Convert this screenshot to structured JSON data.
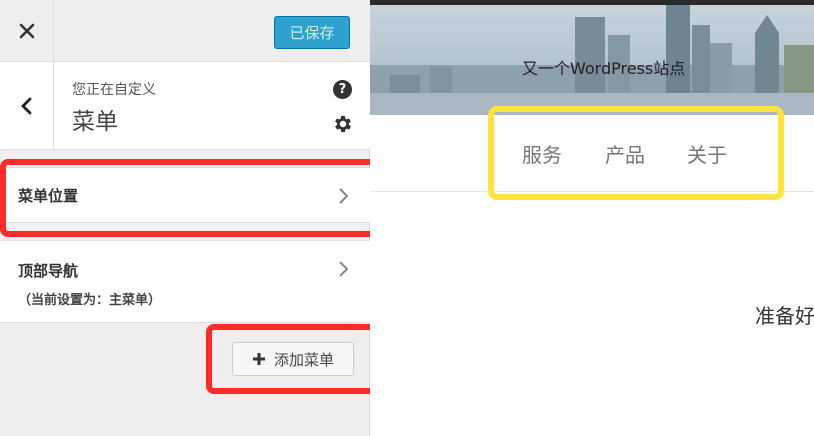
{
  "toolbar": {
    "save_label": "已保存"
  },
  "header": {
    "customizing_label": "您正在自定义",
    "title": "菜单"
  },
  "sections": [
    {
      "title": "菜单位置",
      "subtitle": ""
    },
    {
      "title": "顶部导航",
      "subtitle": "（当前设置为：主菜单）"
    }
  ],
  "add_menu_label": "添加菜单",
  "preview": {
    "tagline": "又一个WordPress站点",
    "nav": [
      "服务",
      "产品",
      "关于"
    ],
    "welcome": "准备好"
  },
  "colors": {
    "save": "#2ea2cc",
    "highlight_red": "#ff2a2a",
    "highlight_yellow": "#ffe23c"
  }
}
